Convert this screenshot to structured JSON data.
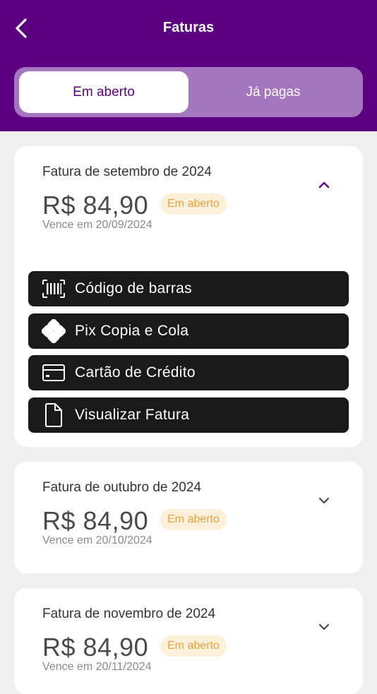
{
  "header": {
    "title": "Faturas",
    "back_icon": "chevron-left-icon",
    "color": "#5a0080"
  },
  "tabs": [
    {
      "label": "Em aberto",
      "active": true
    },
    {
      "label": "Já pagas",
      "active": false
    }
  ],
  "invoices": [
    {
      "title": "Fatura de setembro de 2024",
      "amount": "R$ 84,90",
      "status": "Em aberto",
      "due": "Vence em 20/09/2024",
      "expanded": true
    },
    {
      "title": "Fatura de outubro de 2024",
      "amount": "R$ 84,90",
      "status": "Em aberto",
      "due": "Vence em 20/10/2024",
      "expanded": false
    },
    {
      "title": "Fatura de novembro de 2024",
      "amount": "R$ 84,90",
      "status": "Em aberto",
      "due": "Vence em 20/11/2024",
      "expanded": false
    }
  ],
  "actions": [
    {
      "label": "Código de barras",
      "icon": "barcode-icon"
    },
    {
      "label": "Pix Copia e Cola",
      "icon": "pix-icon"
    },
    {
      "label": "Cartão de Crédito",
      "icon": "credit-card-icon"
    },
    {
      "label": "Visualizar Fatura",
      "icon": "document-icon"
    }
  ],
  "colors": {
    "badge_bg": "#fdf0d8",
    "badge_text": "#e8a23c",
    "action_bg": "#1a1a1a"
  }
}
